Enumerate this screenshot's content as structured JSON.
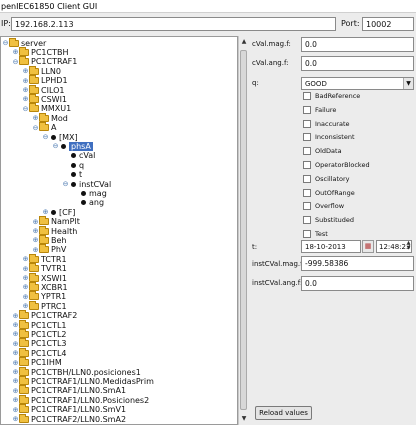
{
  "window": {
    "title": "penIEC61850 Client GUI"
  },
  "connection": {
    "ip_label": "IP:",
    "ip_value": "192.168.2.113",
    "port_label": "Port:",
    "port_value": "10002"
  },
  "tree": {
    "rows": [
      {
        "label": "server",
        "kind": "folder",
        "toggle": "⊖"
      },
      {
        "label": "PC1CTBH",
        "kind": "folder",
        "toggle": "⊕"
      },
      {
        "label": "PC1CTRAF1",
        "kind": "folder",
        "toggle": "⊖"
      },
      {
        "label": "LLN0",
        "kind": "folder",
        "toggle": "⊕"
      },
      {
        "label": "LPHD1",
        "kind": "folder",
        "toggle": "⊕"
      },
      {
        "label": "CILO1",
        "kind": "folder",
        "toggle": "⊕"
      },
      {
        "label": "CSWI1",
        "kind": "folder",
        "toggle": "⊕"
      },
      {
        "label": "MMXU1",
        "kind": "folder",
        "toggle": "⊖"
      },
      {
        "label": "Mod",
        "kind": "folder",
        "toggle": "⊕"
      },
      {
        "label": "A",
        "kind": "folder",
        "toggle": "⊖"
      },
      {
        "label": "[MX]",
        "kind": "dot",
        "toggle": "⊖"
      },
      {
        "label": "phsA",
        "kind": "dot",
        "toggle": "⊖"
      },
      {
        "label": "cVal",
        "kind": "dot",
        "toggle": ""
      },
      {
        "label": "q",
        "kind": "dot",
        "toggle": ""
      },
      {
        "label": "t",
        "kind": "dot",
        "toggle": ""
      },
      {
        "label": "instCVal",
        "kind": "dot",
        "toggle": "⊖"
      },
      {
        "label": "mag",
        "kind": "dot",
        "toggle": ""
      },
      {
        "label": "ang",
        "kind": "dot",
        "toggle": ""
      },
      {
        "label": "[CF]",
        "kind": "dot",
        "toggle": "⊕"
      },
      {
        "label": "NamPlt",
        "kind": "folder",
        "toggle": "⊕"
      },
      {
        "label": "Health",
        "kind": "folder",
        "toggle": "⊕"
      },
      {
        "label": "Beh",
        "kind": "folder",
        "toggle": "⊕"
      },
      {
        "label": "PhV",
        "kind": "folder",
        "toggle": "⊕"
      },
      {
        "label": "TCTR1",
        "kind": "folder",
        "toggle": "⊕"
      },
      {
        "label": "TVTR1",
        "kind": "folder",
        "toggle": "⊕"
      },
      {
        "label": "XSWI1",
        "kind": "folder",
        "toggle": "⊕"
      },
      {
        "label": "XCBR1",
        "kind": "folder",
        "toggle": "⊕"
      },
      {
        "label": "YPTR1",
        "kind": "folder",
        "toggle": "⊕"
      },
      {
        "label": "PTRC1",
        "kind": "folder",
        "toggle": "⊕"
      },
      {
        "label": "PC1CTRAF2",
        "kind": "folder",
        "toggle": "⊕"
      },
      {
        "label": "PC1CTL1",
        "kind": "folder",
        "toggle": "⊕"
      },
      {
        "label": "PC1CTL2",
        "kind": "folder",
        "toggle": "⊕"
      },
      {
        "label": "PC1CTL3",
        "kind": "folder",
        "toggle": "⊕"
      },
      {
        "label": "PC1CTL4",
        "kind": "folder",
        "toggle": "⊕"
      },
      {
        "label": "PC1IHM",
        "kind": "folder",
        "toggle": "⊕"
      },
      {
        "label": "PC1CTBH/LLN0.posiciones1",
        "kind": "folder",
        "toggle": "⊕"
      },
      {
        "label": "PC1CTRAF1/LLN0.MedidasPrim",
        "kind": "folder",
        "toggle": "⊕"
      },
      {
        "label": "PC1CTRAF1/LLN0.SmA1",
        "kind": "folder",
        "toggle": "⊕"
      },
      {
        "label": "PC1CTRAF1/LLN0.Posiciones2",
        "kind": "folder",
        "toggle": "⊕"
      },
      {
        "label": "PC1CTRAF1/LLN0.SmV1",
        "kind": "folder",
        "toggle": "⊕"
      },
      {
        "label": "PC1CTRAF2/LLN0.SmA2",
        "kind": "folder",
        "toggle": "⊕"
      }
    ]
  },
  "details": {
    "cval_mag_label": "cVal.mag.f:",
    "cval_mag_value": "0.0",
    "cval_ang_label": "cVal.ang.f:",
    "cval_ang_value": "0.0",
    "q_label": "q:",
    "q_value": "GOOD",
    "flags": [
      "BadReference",
      "Failure",
      "Inaccurate",
      "Inconsistent",
      "OldData",
      "OperatorBlocked",
      "Oscillatory",
      "OutOfRange",
      "Overflow",
      "Substituded",
      "Test"
    ],
    "t_label": "t:",
    "t_date": "18-10-2013",
    "t_time": "12:48:23",
    "inst_mag_label": "instCVal.mag.f:",
    "inst_mag_value": "-999.58386",
    "inst_ang_label": "instCVal.ang.f:",
    "inst_ang_value": "0.0",
    "reload_label": "Reload values"
  }
}
